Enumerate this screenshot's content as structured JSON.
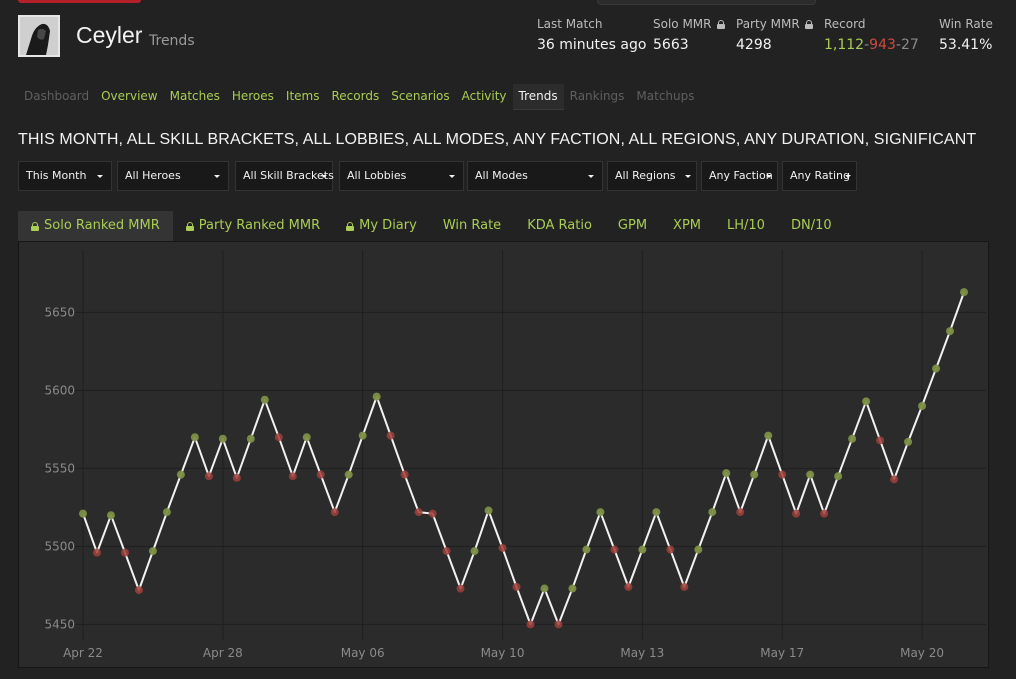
{
  "header": {
    "player_name": "Ceyler",
    "page_subtitle": "Trends",
    "stats": {
      "last_match": {
        "label": "Last Match",
        "value": "36 minutes ago"
      },
      "solo_mmr": {
        "label": "Solo MMR",
        "value": "5663"
      },
      "party_mmr": {
        "label": "Party MMR",
        "value": "4298"
      },
      "record": {
        "label": "Record",
        "wins": "1,112",
        "losses": "943",
        "abandons": "27",
        "separator": "-"
      },
      "win_rate": {
        "label": "Win Rate",
        "value": "53.41%"
      }
    }
  },
  "nav": [
    {
      "label": "Dashboard",
      "state": "muted"
    },
    {
      "label": "Overview",
      "state": "link"
    },
    {
      "label": "Matches",
      "state": "link"
    },
    {
      "label": "Heroes",
      "state": "link"
    },
    {
      "label": "Items",
      "state": "link"
    },
    {
      "label": "Records",
      "state": "link"
    },
    {
      "label": "Scenarios",
      "state": "link"
    },
    {
      "label": "Activity",
      "state": "link"
    },
    {
      "label": "Trends",
      "state": "active"
    },
    {
      "label": "Rankings",
      "state": "muted"
    },
    {
      "label": "Matchups",
      "state": "muted"
    }
  ],
  "filter_summary": "THIS MONTH, ALL SKILL BRACKETS, ALL LOBBIES, ALL MODES, ANY FACTION, ALL REGIONS, ANY DURATION, SIGNIFICANT",
  "filters": [
    "This Month",
    "All Heroes",
    "All Skill Brackets",
    "All Lobbies",
    "All Modes",
    "All Regions",
    "Any Faction",
    "Any Rating"
  ],
  "tabs": [
    {
      "label": "Solo Ranked MMR",
      "locked": true,
      "active": true
    },
    {
      "label": "Party Ranked MMR",
      "locked": true,
      "active": false
    },
    {
      "label": "My Diary",
      "locked": true,
      "active": false
    },
    {
      "label": "Win Rate",
      "locked": false,
      "active": false
    },
    {
      "label": "KDA Ratio",
      "locked": false,
      "active": false
    },
    {
      "label": "GPM",
      "locked": false,
      "active": false
    },
    {
      "label": "XPM",
      "locked": false,
      "active": false
    },
    {
      "label": "LH/10",
      "locked": false,
      "active": false
    },
    {
      "label": "DN/10",
      "locked": false,
      "active": false
    }
  ],
  "colors": {
    "accent_green": "#a9cd55",
    "loss_red": "#cf4b3f",
    "win_marker": "#7c8f45",
    "loss_marker": "#a0403a",
    "line": "#f2f2f2",
    "grid": "#1f1f1f"
  },
  "icons": {
    "lock": "lock-icon",
    "avatar": "player-avatar",
    "dropdown": "caret-down-icon"
  },
  "chart_data": {
    "type": "line",
    "title": "",
    "xlabel": "",
    "ylabel": "",
    "ylim": [
      5440,
      5690
    ],
    "y_ticks": [
      5450,
      5500,
      5550,
      5600,
      5650
    ],
    "x_tick_labels": [
      "Apr 22",
      "Apr 28",
      "May 06",
      "May 10",
      "May 13",
      "May 17",
      "May 20"
    ],
    "grid": true,
    "legend": "none",
    "series": [
      {
        "points": [
          {
            "y": 5521,
            "r": "w"
          },
          {
            "y": 5496,
            "r": "l"
          },
          {
            "y": 5520,
            "r": "w"
          },
          {
            "y": 5496,
            "r": "l"
          },
          {
            "y": 5472,
            "r": "l"
          },
          {
            "y": 5497,
            "r": "w"
          },
          {
            "y": 5522,
            "r": "w"
          },
          {
            "y": 5546,
            "r": "w"
          },
          {
            "y": 5570,
            "r": "w"
          },
          {
            "y": 5545,
            "r": "l"
          },
          {
            "y": 5569,
            "r": "w"
          },
          {
            "y": 5544,
            "r": "l"
          },
          {
            "y": 5569,
            "r": "w"
          },
          {
            "y": 5594,
            "r": "w"
          },
          {
            "y": 5570,
            "r": "l"
          },
          {
            "y": 5545,
            "r": "l"
          },
          {
            "y": 5570,
            "r": "w"
          },
          {
            "y": 5546,
            "r": "l"
          },
          {
            "y": 5522,
            "r": "l"
          },
          {
            "y": 5546,
            "r": "w"
          },
          {
            "y": 5571,
            "r": "w"
          },
          {
            "y": 5596,
            "r": "w"
          },
          {
            "y": 5571,
            "r": "l"
          },
          {
            "y": 5546,
            "r": "l"
          },
          {
            "y": 5522,
            "r": "l"
          },
          {
            "y": 5521,
            "r": "l"
          },
          {
            "y": 5497,
            "r": "l"
          },
          {
            "y": 5473,
            "r": "l"
          },
          {
            "y": 5497,
            "r": "w"
          },
          {
            "y": 5523,
            "r": "w"
          },
          {
            "y": 5499,
            "r": "l"
          },
          {
            "y": 5474,
            "r": "l"
          },
          {
            "y": 5450,
            "r": "l"
          },
          {
            "y": 5473,
            "r": "w"
          },
          {
            "y": 5450,
            "r": "l"
          },
          {
            "y": 5473,
            "r": "w"
          },
          {
            "y": 5498,
            "r": "w"
          },
          {
            "y": 5522,
            "r": "w"
          },
          {
            "y": 5498,
            "r": "l"
          },
          {
            "y": 5474,
            "r": "l"
          },
          {
            "y": 5498,
            "r": "w"
          },
          {
            "y": 5522,
            "r": "w"
          },
          {
            "y": 5498,
            "r": "l"
          },
          {
            "y": 5474,
            "r": "l"
          },
          {
            "y": 5498,
            "r": "w"
          },
          {
            "y": 5522,
            "r": "w"
          },
          {
            "y": 5547,
            "r": "w"
          },
          {
            "y": 5522,
            "r": "l"
          },
          {
            "y": 5546,
            "r": "w"
          },
          {
            "y": 5571,
            "r": "w"
          },
          {
            "y": 5546,
            "r": "l"
          },
          {
            "y": 5521,
            "r": "l"
          },
          {
            "y": 5546,
            "r": "w"
          },
          {
            "y": 5521,
            "r": "l"
          },
          {
            "y": 5545,
            "r": "w"
          },
          {
            "y": 5569,
            "r": "w"
          },
          {
            "y": 5593,
            "r": "w"
          },
          {
            "y": 5568,
            "r": "l"
          },
          {
            "y": 5543,
            "r": "l"
          },
          {
            "y": 5567,
            "r": "w"
          },
          {
            "y": 5590,
            "r": "w"
          },
          {
            "y": 5614,
            "r": "w"
          },
          {
            "y": 5638,
            "r": "w"
          },
          {
            "y": 5663,
            "r": "w"
          }
        ]
      }
    ]
  }
}
